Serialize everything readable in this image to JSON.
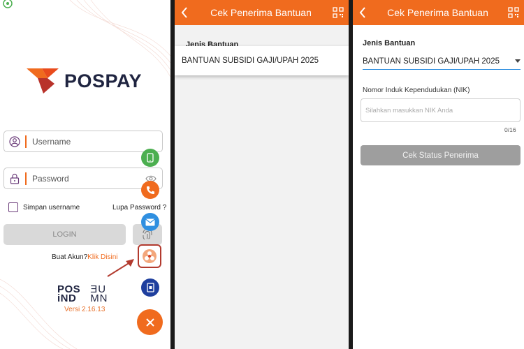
{
  "login": {
    "brand": "POSPAY",
    "username_placeholder": "Username",
    "password_placeholder": "Password",
    "remember_label": "Simpan username",
    "forgot_label": "Lupa Password ?",
    "login_label": "LOGIN",
    "create_account_text": "Buat Akun?",
    "create_account_link": "Klik Disini",
    "posind_line1": "POS",
    "posind_line2": "iND",
    "bumn_line1": "ƎU",
    "bumn_line2": "MN",
    "version": "Versi 2.16.13"
  },
  "screen2": {
    "title": "Cek Penerima Bantuan",
    "field_label": "Jenis Bantuan",
    "dropdown_option": "BANTUAN SUBSIDI GAJI/UPAH 2025"
  },
  "screen3": {
    "title": "Cek Penerima Bantuan",
    "field_label": "Jenis Bantuan",
    "selected_value": "BANTUAN SUBSIDI GAJI/UPAH 2025",
    "nik_label": "Nomor Induk Kependudukan (NIK)",
    "nik_placeholder": "Silahkan masukkan NIK Anda",
    "nik_counter": "0/16",
    "submit_label": "Cek Status Penerima"
  },
  "icons": [
    "wifi-icon",
    "user-icon",
    "lock-icon",
    "eye-icon",
    "phone-icon",
    "call-icon",
    "mail-icon",
    "pos-logo-icon",
    "document-icon",
    "close-icon",
    "fingerprint-icon",
    "back-icon",
    "qr-icon",
    "dropdown-arrow-icon"
  ],
  "colors": {
    "accent": "#f06b1e",
    "navy": "#1f2440",
    "focus": "#2f8fe0",
    "disabled": "#9e9e9e",
    "highlight": "#b23a2e"
  }
}
